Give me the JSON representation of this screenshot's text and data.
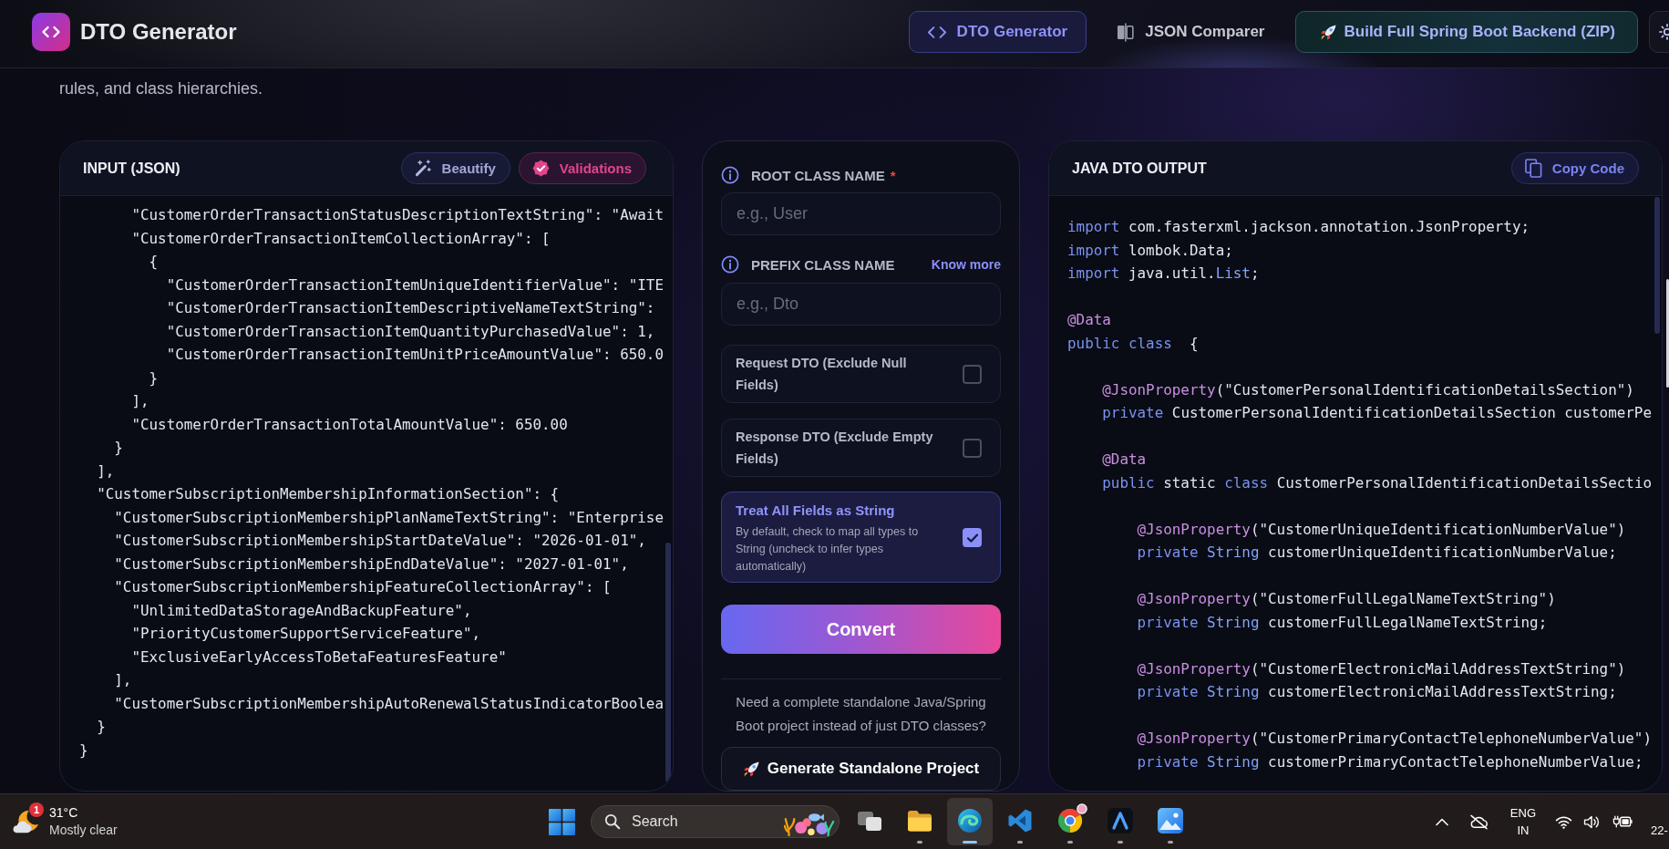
{
  "header": {
    "app_title": "DTO Generator",
    "tabs": [
      {
        "label": "DTO Generator",
        "kind": "generator",
        "selected": true
      },
      {
        "label": "JSON Comparer",
        "kind": "comparer",
        "selected": false
      }
    ],
    "cta_button": {
      "label": "Build Full Spring Boot Backend (ZIP)"
    }
  },
  "intro": {
    "text": "rules, and class hierarchies."
  },
  "input_panel": {
    "title": "INPUT (JSON)",
    "buttons": [
      {
        "label": "Beautify",
        "kind": "beautify"
      },
      {
        "label": "Validations",
        "kind": "validate"
      }
    ],
    "lines": [
      "      \"CustomerOrderTransactionStatusDescriptionTextString\": \"Await",
      "      \"CustomerOrderTransactionItemCollectionArray\": [",
      "        {",
      "          \"CustomerOrderTransactionItemUniqueIdentifierValue\": \"ITE",
      "          \"CustomerOrderTransactionItemDescriptiveNameTextString\":",
      "          \"CustomerOrderTransactionItemQuantityPurchasedValue\": 1,",
      "          \"CustomerOrderTransactionItemUnitPriceAmountValue\": 650.0",
      "        }",
      "      ],",
      "      \"CustomerOrderTransactionTotalAmountValue\": 650.00",
      "    }",
      "  ],",
      "  \"CustomerSubscriptionMembershipInformationSection\": {",
      "    \"CustomerSubscriptionMembershipPlanNameTextString\": \"Enterprise",
      "    \"CustomerSubscriptionMembershipStartDateValue\": \"2026-01-01\",",
      "    \"CustomerSubscriptionMembershipEndDateValue\": \"2027-01-01\",",
      "    \"CustomerSubscriptionMembershipFeatureCollectionArray\": [",
      "      \"UnlimitedDataStorageAndBackupFeature\",",
      "      \"PriorityCustomerSupportServiceFeature\",",
      "      \"ExclusiveEarlyAccessToBetaFeaturesFeature\"",
      "    ],",
      "    \"CustomerSubscriptionMembershipAutoRenewalStatusIndicatorBoolea",
      "  }",
      "}"
    ]
  },
  "options_panel": {
    "fields": [
      {
        "label": "ROOT CLASS NAME",
        "required_mark": "*",
        "placeholder": "e.g., User"
      },
      {
        "label": "PREFIX CLASS NAME",
        "link": "Know more",
        "placeholder": "e.g., Dto"
      }
    ],
    "options": [
      {
        "title": "Request DTO (Exclude Null Fields)",
        "checked": false
      },
      {
        "title": "Response DTO (Exclude Empty Fields)",
        "checked": false
      },
      {
        "title": "Treat All Fields as String",
        "description": "By default, check to map all types to String (uncheck to infer types automatically)",
        "checked": true
      }
    ],
    "convert_button": "Convert",
    "standalone_note": "Need a complete standalone Java/Spring Boot project instead of just DTO classes?",
    "standalone_button": "Generate Standalone Project"
  },
  "output_panel": {
    "title": "JAVA DTO OUTPUT",
    "copy_button": "Copy Code",
    "blocks": [
      {
        "lines": [
          [
            {
              "kind": "keyword",
              "text": "import"
            },
            {
              "kind": "plain",
              "text": " com.fasterxml.jackson.annotation.JsonProperty;"
            }
          ],
          [
            {
              "kind": "keyword",
              "text": "import"
            },
            {
              "kind": "plain",
              "text": " lombok.Data;"
            }
          ],
          [
            {
              "kind": "keyword",
              "text": "import"
            },
            {
              "kind": "plain",
              "text": " java.util."
            },
            {
              "kind": "type",
              "text": "List"
            },
            {
              "kind": "plain",
              "text": ";"
            }
          ]
        ]
      },
      {
        "lines": [
          [
            {
              "kind": "annotation",
              "text": "@Data"
            }
          ],
          [
            {
              "kind": "keyword",
              "text": "public class"
            },
            {
              "kind": "plain",
              "text": "  {"
            }
          ]
        ]
      },
      {
        "lines": [
          [
            {
              "kind": "annotation",
              "text": "    @JsonProperty"
            },
            {
              "kind": "plain",
              "text": "(\"CustomerPersonalIdentificationDetailsSection\")"
            }
          ],
          [
            {
              "kind": "keyword",
              "text": "    private"
            },
            {
              "kind": "plain",
              "text": " CustomerPersonalIdentificationDetailsSection customerPe"
            }
          ]
        ]
      },
      {
        "lines": [
          [
            {
              "kind": "annotation",
              "text": "    @Data"
            }
          ],
          [
            {
              "kind": "keyword",
              "text": "    public"
            },
            {
              "kind": "plain",
              "text": " static "
            },
            {
              "kind": "keyword",
              "text": "class"
            },
            {
              "kind": "plain",
              "text": " CustomerPersonalIdentificationDetailsSectio"
            }
          ]
        ]
      },
      {
        "lines": [
          [
            {
              "kind": "annotation",
              "text": "        @JsonProperty"
            },
            {
              "kind": "plain",
              "text": "(\"CustomerUniqueIdentificationNumberValue\")"
            }
          ],
          [
            {
              "kind": "keyword",
              "text": "        private"
            },
            {
              "kind": "type",
              "text": " String"
            },
            {
              "kind": "plain",
              "text": " customerUniqueIdentificationNumberValue;"
            }
          ]
        ]
      },
      {
        "lines": [
          [
            {
              "kind": "annotation",
              "text": "        @JsonProperty"
            },
            {
              "kind": "plain",
              "text": "(\"CustomerFullLegalNameTextString\")"
            }
          ],
          [
            {
              "kind": "keyword",
              "text": "        private"
            },
            {
              "kind": "type",
              "text": " String"
            },
            {
              "kind": "plain",
              "text": " customerFullLegalNameTextString;"
            }
          ]
        ]
      },
      {
        "lines": [
          [
            {
              "kind": "annotation",
              "text": "        @JsonProperty"
            },
            {
              "kind": "plain",
              "text": "(\"CustomerElectronicMailAddressTextString\")"
            }
          ],
          [
            {
              "kind": "keyword",
              "text": "        private"
            },
            {
              "kind": "type",
              "text": " String"
            },
            {
              "kind": "plain",
              "text": " customerElectronicMailAddressTextString;"
            }
          ]
        ]
      },
      {
        "lines": [
          [
            {
              "kind": "annotation",
              "text": "        @JsonProperty"
            },
            {
              "kind": "plain",
              "text": "(\"CustomerPrimaryContactTelephoneNumberValue\")"
            }
          ],
          [
            {
              "kind": "keyword",
              "text": "        private"
            },
            {
              "kind": "type",
              "text": " String"
            },
            {
              "kind": "plain",
              "text": " customerPrimaryContactTelephoneNumberValue;"
            }
          ]
        ]
      }
    ]
  },
  "taskbar": {
    "weather": {
      "badge": "1",
      "temperature": "31°C",
      "condition": "Mostly clear"
    },
    "search": {
      "label": "Search"
    },
    "apps": [
      {
        "kind": "taskview",
        "running": false,
        "selected": false
      },
      {
        "kind": "folder",
        "running": true,
        "selected": false
      },
      {
        "kind": "swirl",
        "running": true,
        "selected": true
      },
      {
        "kind": "ribbon",
        "running": true,
        "selected": false
      },
      {
        "kind": "wheel",
        "running": true,
        "selected": false
      },
      {
        "kind": "peak",
        "running": true,
        "selected": false
      },
      {
        "kind": "gallery",
        "running": true,
        "selected": false
      }
    ],
    "language": {
      "primary": "ENG",
      "secondary": "IN"
    },
    "clock": "22-"
  }
}
